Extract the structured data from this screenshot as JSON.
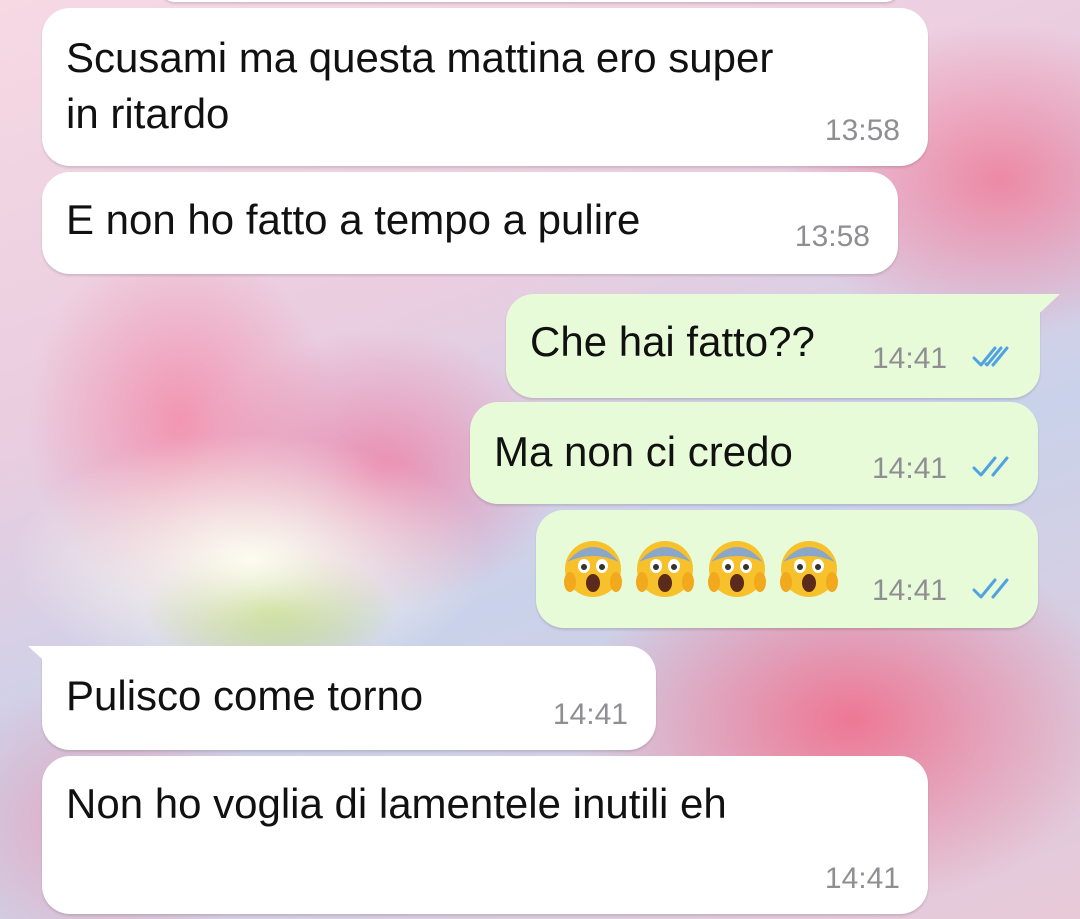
{
  "chat": {
    "messages": [
      {
        "direction": "incoming",
        "text_lines": [
          "Scusami ma questa mattina ero super",
          "in ritardo"
        ],
        "time": "13:58"
      },
      {
        "direction": "incoming",
        "text": "E non ho fatto a tempo a pulire",
        "time": "13:58"
      },
      {
        "direction": "outgoing",
        "text": "Che hai fatto??",
        "time": "14:41",
        "status": "read"
      },
      {
        "direction": "outgoing",
        "text": "Ma non ci credo",
        "time": "14:41",
        "status": "read"
      },
      {
        "direction": "outgoing",
        "emoji": [
          "face-screaming-in-fear",
          "face-screaming-in-fear",
          "face-screaming-in-fear",
          "face-screaming-in-fear"
        ],
        "time": "14:41",
        "status": "read"
      },
      {
        "direction": "incoming",
        "text": "Pulisco come torno",
        "time": "14:41"
      },
      {
        "direction": "incoming",
        "text": "Non ho voglia di lamentele inutili eh",
        "time": "14:41"
      }
    ]
  },
  "colors": {
    "incoming_bubble": "#ffffff",
    "outgoing_bubble": "#e8fbd8",
    "read_ticks": "#4fa3e0",
    "timestamp": "#8e8e93"
  }
}
